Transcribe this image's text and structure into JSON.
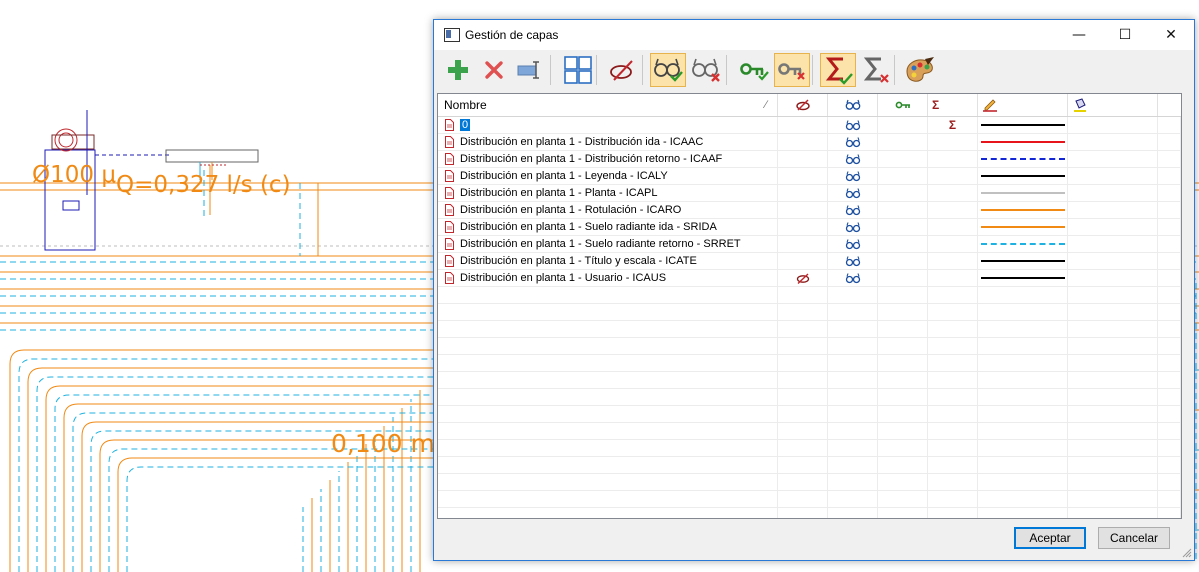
{
  "cad": {
    "dim_text_1": "0,100 m",
    "dim_text_2": "Q=0,327 l/s (c)",
    "dim_text_3": "Ø100 μ"
  },
  "dialog": {
    "title": "Gestión de capas",
    "window_buttons": {
      "minimize": "—",
      "maximize": "☐",
      "close": "✕"
    },
    "toolbar": [
      {
        "name": "add-layer",
        "icon": "plus-icon"
      },
      {
        "name": "delete-layer",
        "icon": "x-icon"
      },
      {
        "name": "rename-layer",
        "icon": "rename-icon"
      },
      {
        "name": "grid-view",
        "icon": "grid-icon"
      },
      {
        "name": "hidden-toggle",
        "icon": "eye-hidden-icon"
      },
      {
        "name": "show-all",
        "icon": "glasses-check-icon",
        "active": true
      },
      {
        "name": "hide-all",
        "icon": "glasses-x-icon"
      },
      {
        "name": "lock-all",
        "icon": "key-check-icon"
      },
      {
        "name": "unlock-all",
        "icon": "key-x-icon",
        "active": true
      },
      {
        "name": "sum-all",
        "icon": "sigma-check-icon",
        "active": true
      },
      {
        "name": "sum-none",
        "icon": "sigma-x-icon"
      },
      {
        "name": "color-palette",
        "icon": "palette-icon"
      }
    ],
    "columns": {
      "name": "Nombre",
      "hidden": "eye-hidden-icon",
      "visible": "glasses-icon",
      "locked": "key-icon",
      "sum": "Σ",
      "line": "pencil-line-icon",
      "fill": "fill-bucket-icon"
    },
    "rows": [
      {
        "name": "0",
        "selected": true,
        "hidden": false,
        "visible": true,
        "sum": "Σ",
        "line_color": "#000000",
        "dash": "solid"
      },
      {
        "name": "Distribución en planta 1 - Distribución ida - ICAAC",
        "visible": true,
        "line_color": "#e8141b",
        "dash": "solid"
      },
      {
        "name": "Distribución en planta 1 - Distribución retorno - ICAAF",
        "visible": true,
        "line_color": "#1427d6",
        "dash": "dashed"
      },
      {
        "name": "Distribución en planta 1 - Leyenda - ICALY",
        "visible": true,
        "line_color": "#000000",
        "dash": "solid"
      },
      {
        "name": "Distribución en planta 1 - Planta - ICAPL",
        "visible": true,
        "line_color": "#c0c0c0",
        "dash": "solid"
      },
      {
        "name": "Distribución en planta 1 - Rotulación - ICARO",
        "visible": true,
        "line_color": "#f08a14",
        "dash": "solid"
      },
      {
        "name": "Distribución en planta 1 - Suelo radiante ida - SRIDA",
        "visible": true,
        "line_color": "#f08a14",
        "dash": "solid"
      },
      {
        "name": "Distribución en planta 1 - Suelo radiante retorno - SRRET",
        "visible": true,
        "line_color": "#1fb2e0",
        "dash": "dashed"
      },
      {
        "name": "Distribución en planta 1 - Título y escala - ICATE",
        "visible": true,
        "line_color": "#000000",
        "dash": "solid"
      },
      {
        "name": "Distribución en planta 1 - Usuario - ICAUS",
        "visible": true,
        "hidden": true,
        "line_color": "#000000",
        "dash": "solid"
      }
    ],
    "buttons": {
      "accept": "Aceptar",
      "cancel": "Cancelar"
    }
  }
}
